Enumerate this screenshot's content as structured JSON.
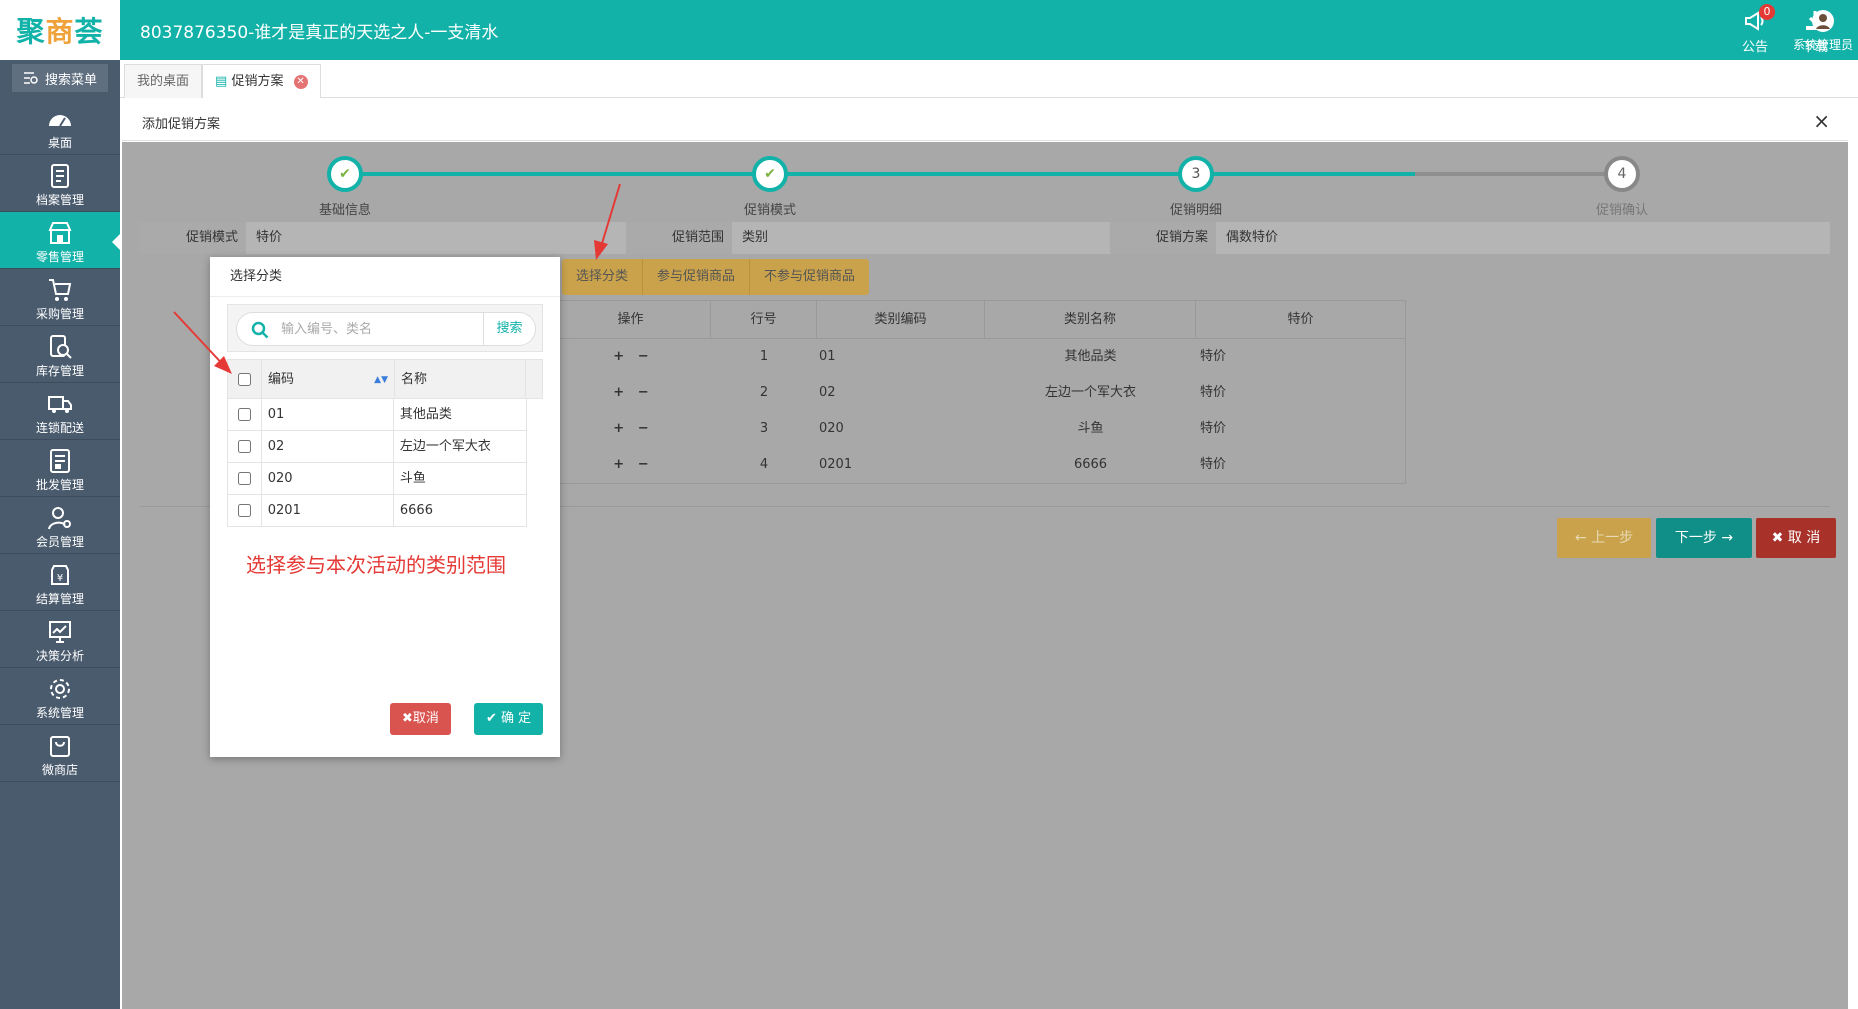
{
  "app": {
    "logo_pre": "聚",
    "logo_mid": "商",
    "logo_post": "荟",
    "title": "8037876350-谁才是真正的天选之人-一支清水"
  },
  "top_tools": {
    "notice_label": "公告",
    "notice_count": "0",
    "download_label": "下载",
    "user_label": "系统管理员"
  },
  "sidebar": {
    "search_label": "搜索菜单",
    "items": [
      {
        "label": "桌面",
        "icon": "dashboard-icon"
      },
      {
        "label": "档案管理",
        "icon": "archive-icon"
      },
      {
        "label": "零售管理",
        "icon": "store-icon"
      },
      {
        "label": "采购管理",
        "icon": "cart-icon"
      },
      {
        "label": "库存管理",
        "icon": "inventory-icon"
      },
      {
        "label": "连锁配送",
        "icon": "truck-icon"
      },
      {
        "label": "批发管理",
        "icon": "wholesale-icon"
      },
      {
        "label": "会员管理",
        "icon": "member-icon"
      },
      {
        "label": "结算管理",
        "icon": "settlement-icon"
      },
      {
        "label": "决策分析",
        "icon": "chart-icon"
      },
      {
        "label": "系统管理",
        "icon": "gear-icon"
      },
      {
        "label": "微商店",
        "icon": "shop-bag-icon"
      }
    ]
  },
  "tabs": [
    {
      "label": "我的桌面"
    },
    {
      "label": "促销方案"
    }
  ],
  "panel": {
    "title": "添加促销方案",
    "close": "×"
  },
  "steps": [
    {
      "label": "基础信息",
      "mark": "✔"
    },
    {
      "label": "促销模式",
      "mark": "✔"
    },
    {
      "label": "促销明细",
      "mark": "3"
    },
    {
      "label": "促销确认",
      "mark": "4"
    }
  ],
  "info": {
    "mode_key": "促销模式",
    "mode_val": "特价",
    "scope_key": "促销范围",
    "scope_val": "类别",
    "plan_key": "促销方案",
    "plan_val": "偶数特价"
  },
  "subtabs": [
    "选择分类",
    "参与促销商品",
    "不参与促销商品"
  ],
  "main_table": {
    "headers": [
      "操作",
      "行号",
      "类别编码",
      "类别名称",
      "特价"
    ],
    "rows": [
      {
        "row": "1",
        "code": "01",
        "name": "其他品类",
        "price": "特价"
      },
      {
        "row": "2",
        "code": "02",
        "name": "左边一个军大衣",
        "price": "特价"
      },
      {
        "row": "3",
        "code": "020",
        "name": "斗鱼",
        "price": "特价"
      },
      {
        "row": "4",
        "code": "0201",
        "name": "6666",
        "price": "特价"
      }
    ]
  },
  "buttons": {
    "prev": "上一步",
    "next": "下一步",
    "cancel": "取 消"
  },
  "modal": {
    "title": "选择分类",
    "search_placeholder": "输入编号、类名",
    "search_button": "搜索",
    "col_code": "编码",
    "col_name": "名称",
    "rows": [
      {
        "code": "01",
        "name": "其他品类"
      },
      {
        "code": "02",
        "name": "左边一个军大衣"
      },
      {
        "code": "020",
        "name": "斗鱼"
      },
      {
        "code": "0201",
        "name": "6666"
      }
    ],
    "note": "选择参与本次活动的类别范围",
    "cancel": "取消",
    "confirm": "确 定"
  },
  "colors": {
    "brand": "#12b2a9",
    "sidebar": "#4a5b6e",
    "warning": "#c9a24b",
    "danger": "#c0392b",
    "annotation": "#e53935"
  }
}
